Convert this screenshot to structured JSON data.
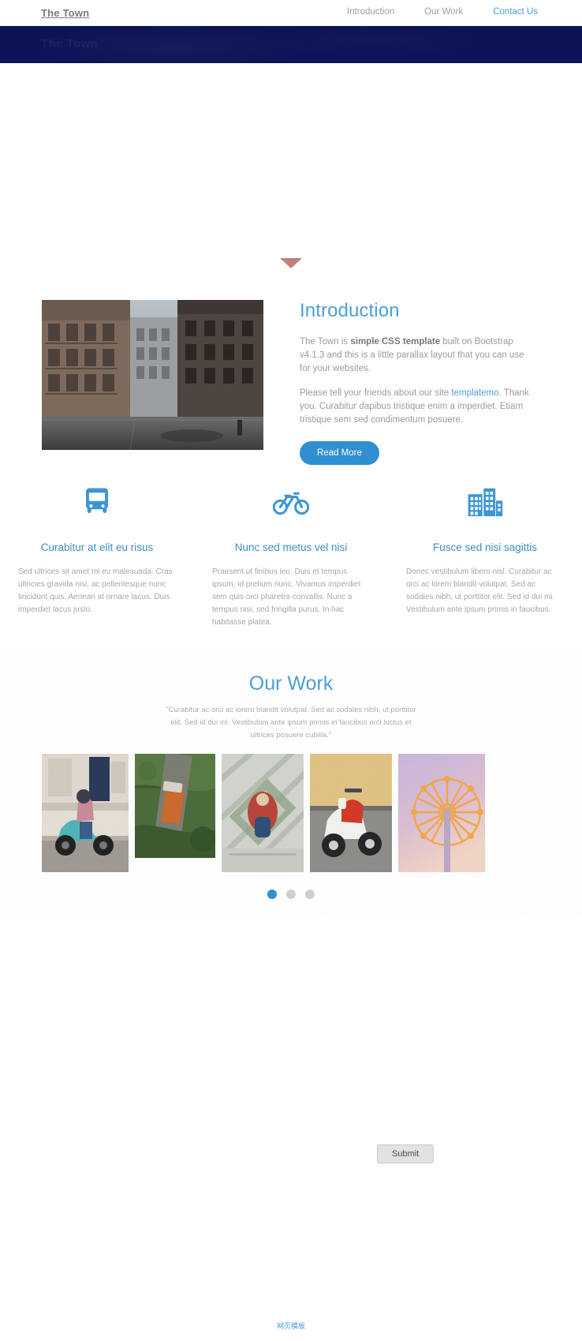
{
  "header": {
    "brand": "The Town",
    "nav": [
      {
        "label": "Introduction",
        "active": false
      },
      {
        "label": "Our Work",
        "active": false
      },
      {
        "label": "Contact Us",
        "active": true
      }
    ]
  },
  "hero": {
    "ghost_title": "The Town",
    "scroll_arrow_color": "#c18080",
    "band_color": "#0c1457"
  },
  "intro": {
    "heading": "Introduction",
    "paragraph1_a": "The Town is ",
    "paragraph1_bold": "simple CSS template",
    "paragraph1_b": " built on Bootstrap v4.1.3 and this is a little parallax layout that you can use for your websites.",
    "paragraph2_a": "Please tell your friends about our site ",
    "paragraph2_link": "templatemo",
    "paragraph2_b": ". Thank you. Curabitur dapibus tristique enim a imperdiet. Etiam tristique sem sed condimentum posuere.",
    "button": "Read More",
    "photo_alt": "narrow-city-street-photo"
  },
  "features": [
    {
      "icon": "bus-icon",
      "title": "Curabitur at elit eu risus",
      "text": "Sed ultrices sit amet mi eu malesuada. Cras ultricies gravida nisi, ac pellentesque nunc tincidunt quis. Aenean at ornare lacus. Duis imperdiet lacus justo."
    },
    {
      "icon": "bicycle-icon",
      "title": "Nunc sed metus vel nisi",
      "text": "Praesent ut finibus leo. Duis et tempus ipsum, id pretium nunc. Vivamus imperdiet sem quis orci pharetra convallis. Nunc a tempus nisi, sed fringilla purus. In hac habitasse platea."
    },
    {
      "icon": "buildings-icon",
      "title": "Fusce sed nisi sagittis",
      "text": "Donec vestibulum libero nisl. Curabitur ac orci ac lorem blandit volutpat. Sed ac sodales nibh, ut porttitor elit. Sed id dui mi. Vestibulum ante ipsum primis in faucibus."
    }
  ],
  "ourwork": {
    "heading": "Our Work",
    "quote": "\"Curabitur ac orci ac lorem blandit volutpat. Sed ac sodales nibh, ut porttitor elit. Sed id dui mi. Vestibulum ante ipsum primis in faucibus orci luctus et ultrices posuere cubilia.\"",
    "gallery": [
      {
        "alt": "scooter-rider-photo"
      },
      {
        "alt": "aerial-truck-road-photo"
      },
      {
        "alt": "aerial-courtyard-photo"
      },
      {
        "alt": "red-white-vespa-photo"
      },
      {
        "alt": "ferris-wheel-photo"
      }
    ],
    "dots": [
      {
        "active": true
      },
      {
        "active": false
      },
      {
        "active": false
      }
    ]
  },
  "contact": {
    "submit_label": "Submit"
  },
  "footer": {
    "link": "网页模板"
  },
  "colors": {
    "accent": "#4a9fd8",
    "button": "#2f8fd0",
    "navy": "#0c1457",
    "muted": "#a0a0a5"
  }
}
